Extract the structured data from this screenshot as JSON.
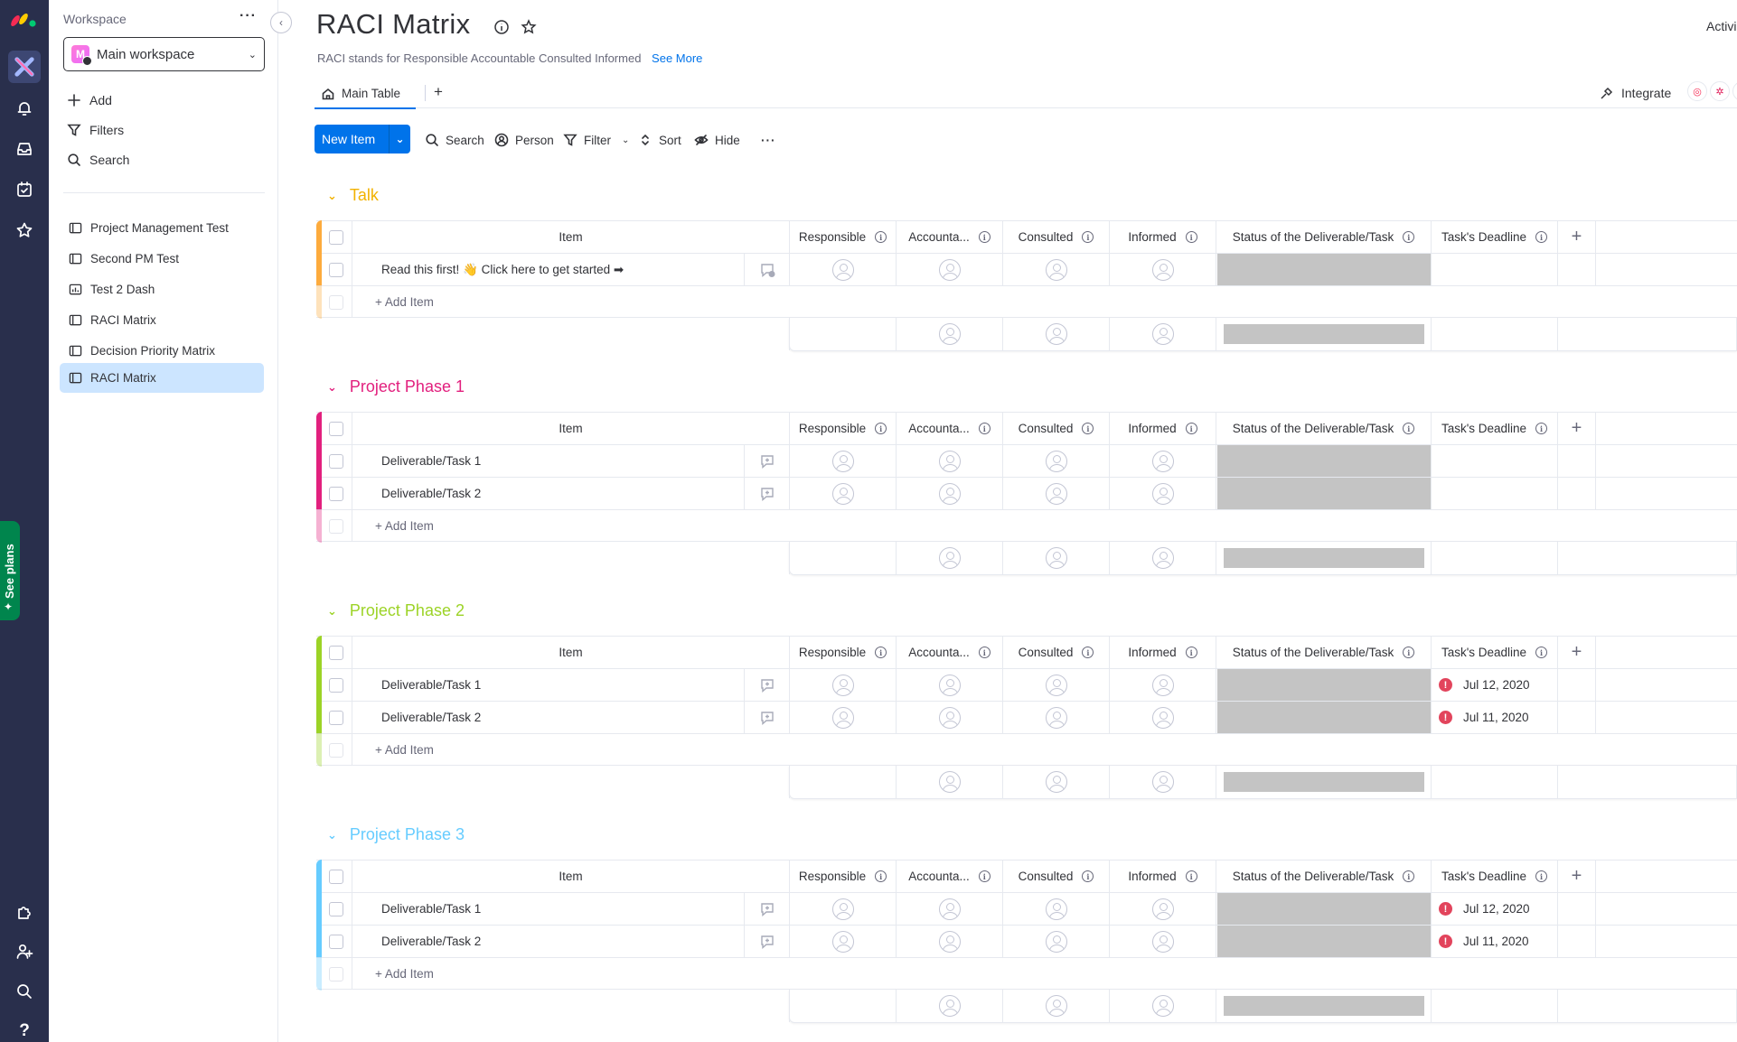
{
  "sidebar": {
    "workspace_label": "Workspace",
    "workspace_name": "Main workspace",
    "workspace_initial": "M",
    "actions": [
      "Add",
      "Filters",
      "Search"
    ],
    "boards": [
      {
        "label": "Project Management Test",
        "icon": "board-icon"
      },
      {
        "label": "Second PM Test",
        "icon": "board-icon"
      },
      {
        "label": "Test 2 Dash",
        "icon": "dashboard-icon"
      },
      {
        "label": "RACI Matrix",
        "icon": "board-icon"
      },
      {
        "label": "Decision Priority Matrix",
        "icon": "board-icon"
      },
      {
        "label": "RACI Matrix",
        "icon": "board-icon",
        "selected": true
      }
    ],
    "see_plans": "See plans"
  },
  "header": {
    "title": "RACI Matrix",
    "description": "RACI stands for Responsible Accountable Consulted Informed",
    "see_more": "See More",
    "activity": "Activi"
  },
  "views": {
    "main_table": "Main Table",
    "add": "+",
    "integrate": "Integrate"
  },
  "toolbar": {
    "new_item": "New Item",
    "search": "Search",
    "person": "Person",
    "filter": "Filter",
    "sort": "Sort",
    "hide": "Hide"
  },
  "columns": {
    "item": "Item",
    "responsible": "Responsible",
    "accountable": "Accounta...",
    "consulted": "Consulted",
    "informed": "Informed",
    "status": "Status of the Deliverable/Task",
    "deadline": "Task's Deadline"
  },
  "add_item_label": "+ Add Item",
  "colors": {
    "primary": "#0073ea",
    "talk": "#fdab3d",
    "phase1": "#e2207e",
    "phase2": "#9cd326",
    "phase3": "#66ccff",
    "status_empty": "#c4c4c4",
    "alert": "#e2445c"
  },
  "groups": [
    {
      "title": "Talk",
      "color": "#fdab3d",
      "title_color": "#f2b200",
      "rows": [
        {
          "item": "Read this first! 👋 Click here to get started ➡",
          "deadline": "",
          "overdue": false
        }
      ]
    },
    {
      "title": "Project Phase 1",
      "color": "#e2207e",
      "title_color": "#e2207e",
      "rows": [
        {
          "item": "Deliverable/Task 1",
          "deadline": "",
          "overdue": false
        },
        {
          "item": "Deliverable/Task 2",
          "deadline": "",
          "overdue": false
        }
      ]
    },
    {
      "title": "Project Phase 2",
      "color": "#9cd326",
      "title_color": "#9cd326",
      "rows": [
        {
          "item": "Deliverable/Task 1",
          "deadline": "Jul 12, 2020",
          "overdue": true
        },
        {
          "item": "Deliverable/Task 2",
          "deadline": "Jul 11, 2020",
          "overdue": true
        }
      ]
    },
    {
      "title": "Project Phase 3",
      "color": "#66ccff",
      "title_color": "#66ccff",
      "rows": [
        {
          "item": "Deliverable/Task 1",
          "deadline": "Jul 12, 2020",
          "overdue": true
        },
        {
          "item": "Deliverable/Task 2",
          "deadline": "Jul 11, 2020",
          "overdue": true
        }
      ]
    }
  ]
}
